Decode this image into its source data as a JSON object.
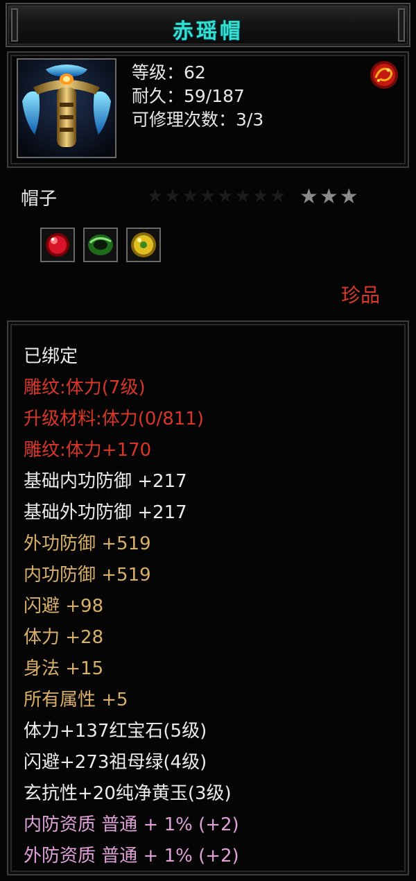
{
  "title": "赤瑶帽",
  "stats": {
    "level": "等级：62",
    "durability": "耐久：59/187",
    "repairs": "可修理次数：3/3"
  },
  "item_type": "帽子",
  "stars": "★★★",
  "stars_faint": "★★★★★★★★",
  "gems": [
    {
      "name": "ruby-gem-icon",
      "color": "#c8101a"
    },
    {
      "name": "emerald-gem-icon",
      "color": "#2f9a2a"
    },
    {
      "name": "yellow-jade-gem-icon",
      "color": "#d8b41a"
    }
  ],
  "rarity": "珍品",
  "colors": {
    "white": "#ececec",
    "red": "#d9362a",
    "gold": "#d8b06a",
    "pink": "#e0a0d8",
    "title": "#33e0d0"
  },
  "attributes": [
    {
      "text": "已绑定",
      "color": "white"
    },
    {
      "text": "雕纹:体力(7级)",
      "color": "red"
    },
    {
      "text": "升级材料:体力(0/811)",
      "color": "red"
    },
    {
      "text": "雕纹:体力+170",
      "color": "red"
    },
    {
      "text": "基础内功防御 +217",
      "color": "white"
    },
    {
      "text": "基础外功防御 +217",
      "color": "white"
    },
    {
      "text": "外功防御 +519",
      "color": "gold"
    },
    {
      "text": "内功防御 +519",
      "color": "gold"
    },
    {
      "text": "闪避 +98",
      "color": "gold"
    },
    {
      "text": "体力 +28",
      "color": "gold"
    },
    {
      "text": "身法 +15",
      "color": "gold"
    },
    {
      "text": "所有属性 +5",
      "color": "gold"
    },
    {
      "text": "体力+137红宝石(5级)",
      "color": "white"
    },
    {
      "text": "闪避+273祖母绿(4级)",
      "color": "white"
    },
    {
      "text": "玄抗性+20纯净黄玉(3级)",
      "color": "white"
    },
    {
      "text": "内防资质 普通 + 1% (+2)",
      "color": "pink"
    },
    {
      "text": "外防资质 普通 + 1% (+2)",
      "color": "pink"
    }
  ]
}
